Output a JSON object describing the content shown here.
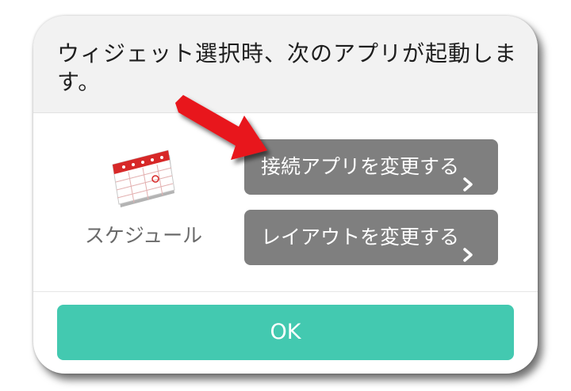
{
  "dialog": {
    "message": "ウィジェット選択時、次のアプリが起動します。",
    "app": {
      "icon": "calendar-icon",
      "label": "スケジュール"
    },
    "buttons": {
      "change_app": "接続アプリを変更する",
      "change_layout": "レイアウトを変更する",
      "ok": "OK"
    }
  },
  "colors": {
    "header_bg": "#f2f2f2",
    "action_button": "#7f7f7f",
    "ok_button": "#43c9b0",
    "annotation_arrow": "#e8141b"
  }
}
